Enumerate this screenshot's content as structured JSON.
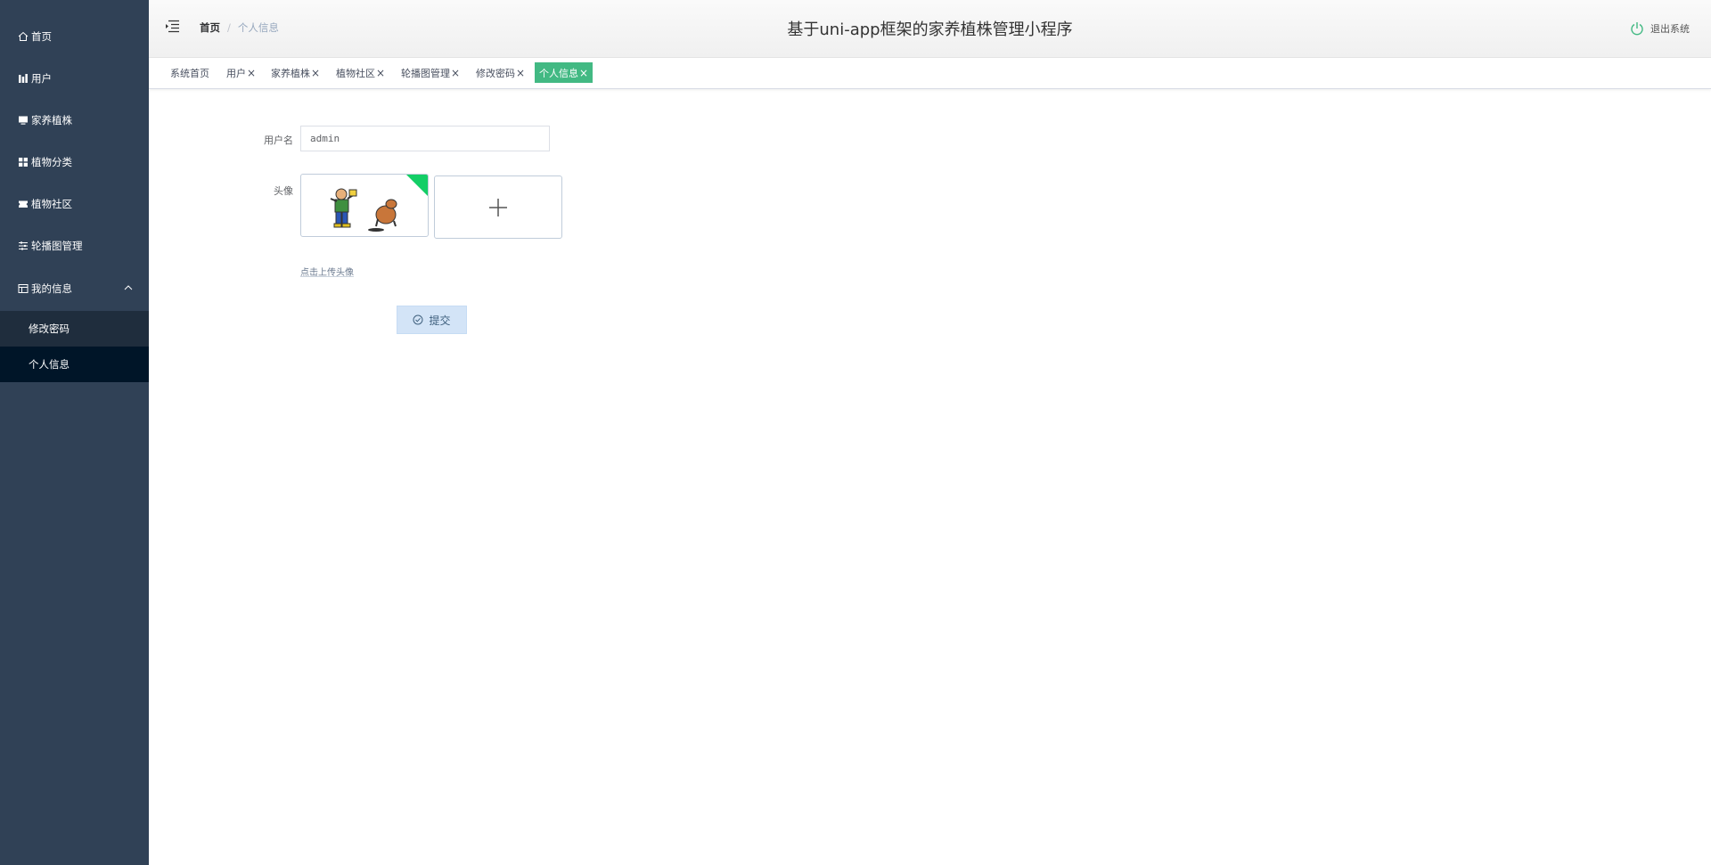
{
  "sidebar": {
    "items": [
      {
        "label": "首页",
        "icon": "home-icon"
      },
      {
        "label": "用户",
        "icon": "chart-icon"
      },
      {
        "label": "家养植株",
        "icon": "monitor-icon"
      },
      {
        "label": "植物分类",
        "icon": "grid-icon"
      },
      {
        "label": "植物社区",
        "icon": "ticket-icon"
      },
      {
        "label": "轮播图管理",
        "icon": "sliders-icon"
      },
      {
        "label": "我的信息",
        "icon": "calendar-icon",
        "expanded": true
      }
    ],
    "subitems": [
      {
        "label": "修改密码",
        "active": false
      },
      {
        "label": "个人信息",
        "active": true
      }
    ],
    "colors": {
      "background": "#304156",
      "submenu": "#1f2d3d",
      "active": "#001528"
    }
  },
  "header": {
    "breadcrumb": {
      "home": "首页",
      "separator": "/",
      "current": "个人信息"
    },
    "title": "基于uni-app框架的家养植株管理小程序",
    "logout": "退出系统"
  },
  "tags": [
    {
      "label": "系统首页",
      "closable": false
    },
    {
      "label": "用户",
      "closable": true
    },
    {
      "label": "家养植株",
      "closable": true
    },
    {
      "label": "植物社区",
      "closable": true
    },
    {
      "label": "轮播图管理",
      "closable": true
    },
    {
      "label": "修改密码",
      "closable": true
    },
    {
      "label": "个人信息",
      "closable": true,
      "active": true
    }
  ],
  "tag_close_glyph": "×",
  "form": {
    "username_label": "用户名",
    "username_value": "admin",
    "avatar_label": "头像",
    "upload_hint": "点击上传头像",
    "submit_label": "提交"
  },
  "colors": {
    "accent": "#42b983",
    "upload_success": "#13ce66",
    "submit_bg": "#d3e4f7"
  }
}
